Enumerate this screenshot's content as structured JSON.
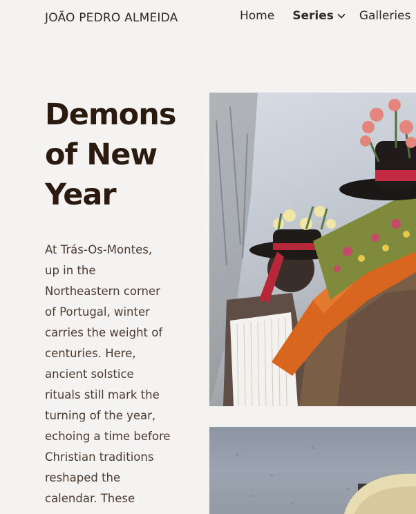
{
  "header": {
    "brand": "JOÃO PEDRO ALMEIDA",
    "nav": {
      "home": "Home",
      "series": "Series",
      "galleries": "Galleries"
    }
  },
  "article": {
    "title_lines": [
      "Demons",
      "of New",
      "Year"
    ],
    "intro_lines": [
      "At Trás-Os-Montes,",
      "up in the",
      "Northeastern corner",
      "of Portugal, winter",
      "carries the weight of",
      "centuries. Here,",
      "ancient solstice",
      "rituals still mark the",
      "turning of the year,",
      "echoing a time before",
      "Christian traditions",
      "reshaped the",
      "calendar. These"
    ]
  },
  "icons": {
    "series_dropdown": "chevron-down-icon"
  },
  "colors": {
    "background": "#f5f3f1",
    "title": "#2b1a0f",
    "text": "#4a3a30"
  }
}
